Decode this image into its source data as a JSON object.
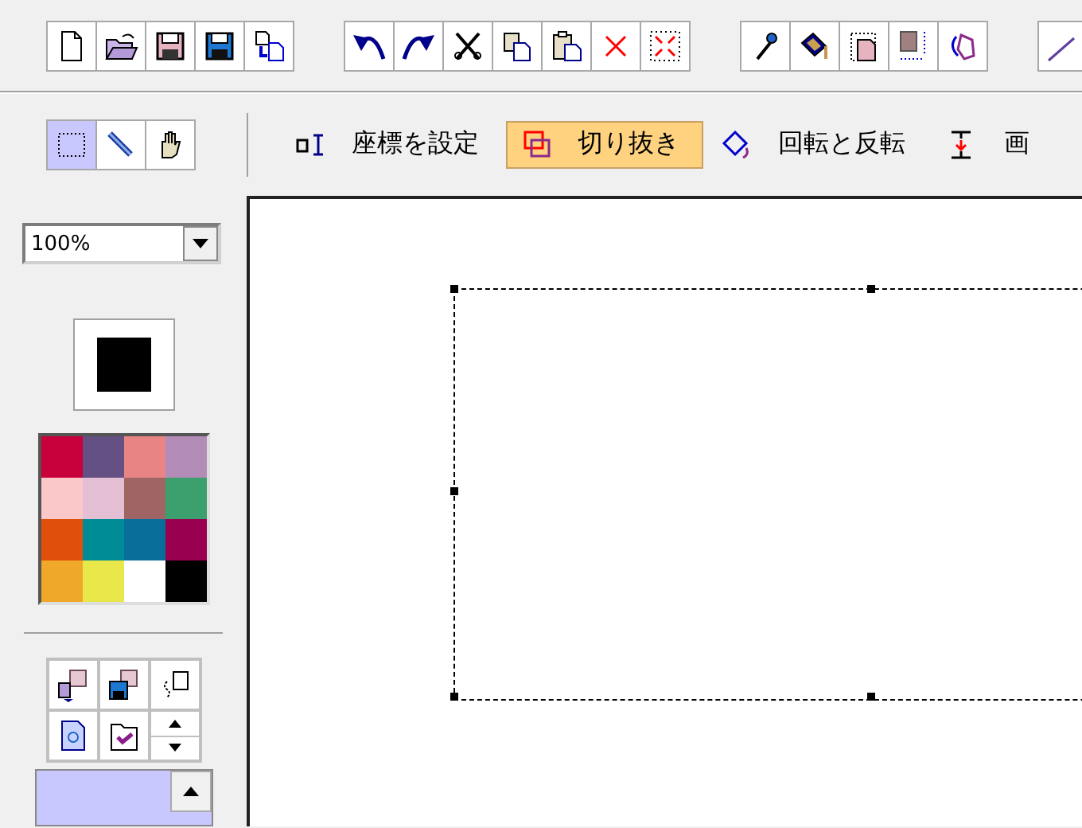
{
  "tools": [
    {
      "selected": true
    },
    {
      "selected": false
    },
    {
      "selected": false
    }
  ],
  "commands": [
    {
      "label": "座標を設定",
      "selected": false
    },
    {
      "label": "切り抜き",
      "selected": true
    },
    {
      "label": "回転と反転",
      "selected": false
    },
    {
      "label": "画",
      "selected": false
    }
  ],
  "zoom": {
    "value": "100%"
  },
  "palette": [
    {
      "color": "#c8003c"
    },
    {
      "color": "#645082"
    },
    {
      "color": "#e88484"
    },
    {
      "color": "#b48cb8"
    },
    {
      "color": "#fac8c8"
    },
    {
      "color": "#e4bed2"
    },
    {
      "color": "#a06464"
    },
    {
      "color": "#3ca06e"
    },
    {
      "color": "#e0500a"
    },
    {
      "color": "#008c96"
    },
    {
      "color": "#0a6e9a"
    },
    {
      "color": "#9a0050"
    },
    {
      "color": "#f0a82a"
    },
    {
      "color": "#e8e84a"
    },
    {
      "color": "#ffffff"
    },
    {
      "color": "#000000"
    }
  ]
}
